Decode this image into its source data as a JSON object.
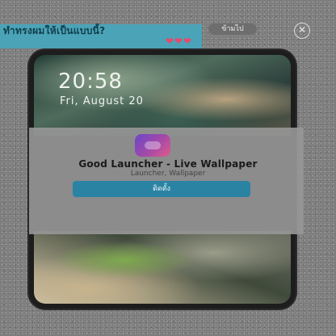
{
  "ad": {
    "text": "ทำทรงผมให้เป็นแบบนี้?",
    "hearts": "❤❤❤",
    "skip_label": "ข้ามไป",
    "close_glyph": "✕"
  },
  "lockscreen": {
    "time": "20:58",
    "date": "Fri, August 20"
  },
  "app": {
    "name": "Good Launcher - Live Wallpaper",
    "subtitle": "Launcher, Wallpaper",
    "install_label": "ติดตั้ง"
  },
  "colors": {
    "banner": "#4ba3b8",
    "button": "#2b83a3",
    "icon_gradient_start": "#6a47c9",
    "icon_gradient_end": "#e05b8a"
  }
}
